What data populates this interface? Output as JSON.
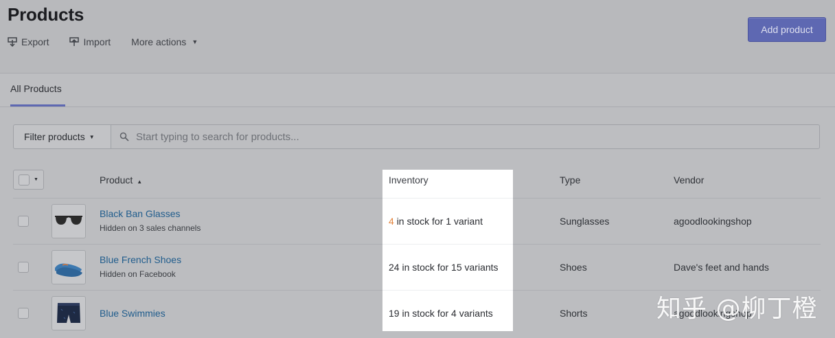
{
  "header": {
    "title": "Products",
    "actions": [
      {
        "label": "Export",
        "icon": "export-icon"
      },
      {
        "label": "Import",
        "icon": "import-icon"
      },
      {
        "label": "More actions",
        "icon": "caret-down-icon"
      }
    ],
    "add_button": "Add product"
  },
  "tabs": [
    {
      "label": "All Products",
      "active": true
    }
  ],
  "filter": {
    "button_label": "Filter products",
    "search_placeholder": "Start typing to search for products..."
  },
  "table": {
    "columns": {
      "product": "Product",
      "inventory": "Inventory",
      "type": "Type",
      "vendor": "Vendor"
    },
    "rows": [
      {
        "name": "Black Ban Glasses",
        "subtext": "Hidden on 3 sales channels",
        "inventory_count": "4",
        "inventory_rest": "in stock for 1 variant",
        "type": "Sunglasses",
        "vendor": "agoodlookingshop",
        "thumb_icon": "sunglasses-icon"
      },
      {
        "name": "Blue French Shoes",
        "subtext": "Hidden on Facebook",
        "inventory_count": "24",
        "inventory_rest": "in stock for 15 variants",
        "type": "Shoes",
        "vendor": "Dave's feet and hands",
        "thumb_icon": "shoes-icon"
      },
      {
        "name": "Blue Swimmies",
        "subtext": "",
        "inventory_count": "19",
        "inventory_rest": "in stock for 4 variants",
        "type": "Shorts",
        "vendor": "agoodlookingshop",
        "thumb_icon": "swim-shorts-icon"
      }
    ]
  },
  "watermark": "知乎 @柳丁橙",
  "colors": {
    "accent": "#5e68b2",
    "link": "#1f5c8c",
    "low_stock": "#e3823a"
  }
}
